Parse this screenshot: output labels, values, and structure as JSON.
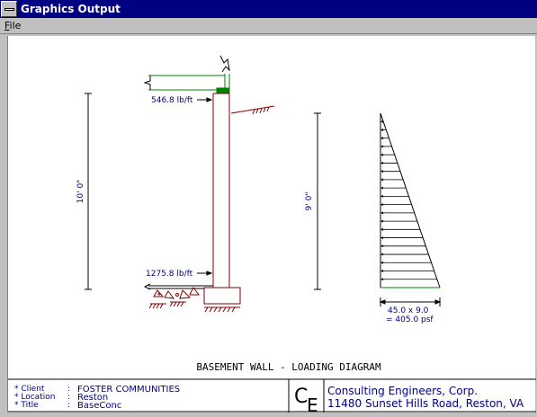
{
  "window": {
    "title": "Graphics Output"
  },
  "menu": {
    "file_label": "File",
    "file_mnemonic": "F",
    "file_rest": "ile"
  },
  "drawing": {
    "top_load": "546.8 lb/ft",
    "bottom_load": "1275.8 lb/ft",
    "wall_height": "10' 0\"",
    "soil_height": "9' 0\"",
    "pressure_calc": "45.0 x 9.0",
    "pressure_result": "= 405.0 psf",
    "title": "BASEMENT WALL - LOADING DIAGRAM"
  },
  "title_block": {
    "labels": [
      "* Client",
      "* Location",
      "* Title"
    ],
    "colons": [
      ":",
      ":",
      ":"
    ],
    "values": [
      "FOSTER COMMUNITIES",
      "Reston",
      "BaseConc"
    ],
    "logo_text": "CE",
    "company_name": "Consulting Engineers, Corp.",
    "company_address": "11480 Sunset Hills Road, Reston, VA"
  },
  "colors": {
    "titlebar": "#000080",
    "wall_line": "#800000",
    "joist_line": "#008000",
    "text_dark": "#000080"
  }
}
